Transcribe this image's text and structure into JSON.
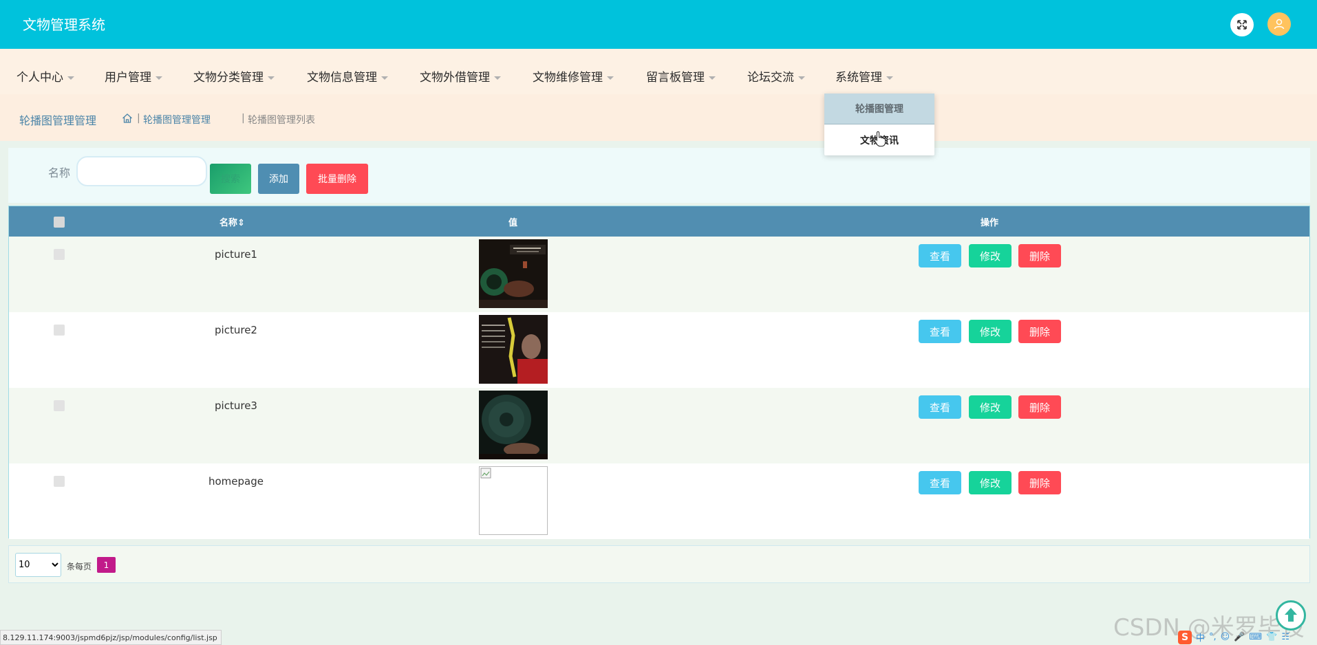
{
  "app": {
    "title": "文物管理系统"
  },
  "header": {
    "fullscreen_icon": "fullscreen-icon",
    "avatar_icon": "user-avatar-icon",
    "avatar_color": "#ffc35e"
  },
  "nav": {
    "items": [
      {
        "label": "个人中心"
      },
      {
        "label": "用户管理"
      },
      {
        "label": "文物分类管理"
      },
      {
        "label": "文物信息管理"
      },
      {
        "label": "文物外借管理"
      },
      {
        "label": "文物维修管理"
      },
      {
        "label": "留言板管理"
      },
      {
        "label": "论坛交流"
      },
      {
        "label": "系统管理"
      }
    ],
    "dropdown": [
      {
        "label": "轮播图管理",
        "state": "active"
      },
      {
        "label": "文物资讯",
        "state": "hover"
      }
    ]
  },
  "breadcrumb": {
    "title": "轮播图管理管理",
    "home_icon": "home-icon",
    "link": "轮播图管理管理",
    "separator": "|",
    "current": "轮播图管理列表"
  },
  "search": {
    "label": "名称",
    "input_value": "",
    "search_button": "搜索",
    "add_button": "添加",
    "batch_delete_button": "批量删除"
  },
  "table": {
    "columns": {
      "name": "名称",
      "sort_icon": "⇕",
      "value": "值",
      "actions": "操作"
    },
    "rows": [
      {
        "name": "picture1",
        "image": "loaded"
      },
      {
        "name": "picture2",
        "image": "loaded"
      },
      {
        "name": "picture3",
        "image": "loaded"
      },
      {
        "name": "homepage",
        "image": "broken"
      }
    ],
    "actions": {
      "view": "查看",
      "edit": "修改",
      "delete": "删除"
    }
  },
  "pagination": {
    "page_size": "10",
    "page_size_options": [
      "10"
    ],
    "per_page_label": "条每页",
    "current_page": "1"
  },
  "status_bar": {
    "url": "8.129.11.174:9003/jspmd6pjz/jsp/modules/config/list.jsp"
  },
  "watermark": {
    "text": "CSDN @米罗毕设"
  },
  "ime": {
    "logo": "S",
    "items": [
      "中",
      "°,",
      "☺",
      "🎤",
      "⌨",
      "👕",
      "☷"
    ]
  },
  "colors": {
    "header": "#00c2dc",
    "nav_bg": "#fdf1e4",
    "table_head": "#518eb1",
    "view": "#46c7ee",
    "edit": "#16d39a",
    "delete": "#ff4a55",
    "page_active": "#c11a8a"
  }
}
